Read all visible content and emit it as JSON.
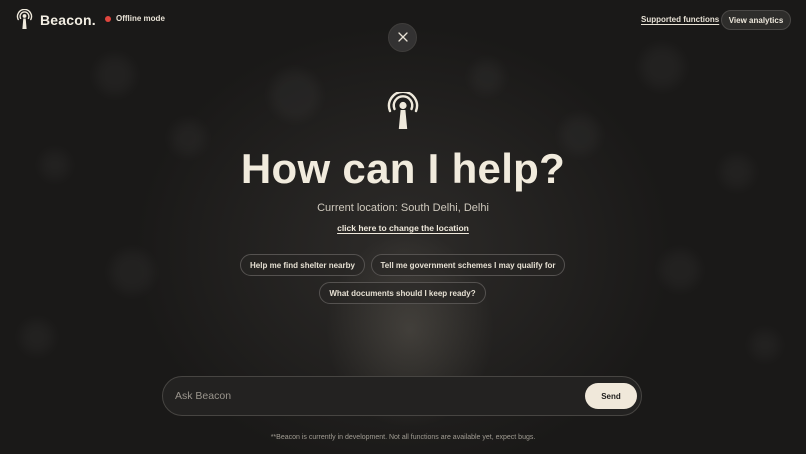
{
  "header": {
    "brand_name": "Beacon.",
    "offline_label": "Offline mode",
    "supported_link": "Supported functions",
    "analytics_button": "View analytics"
  },
  "hero": {
    "title": "How can I help?",
    "location_text": "Current location: South Delhi, Delhi",
    "change_location_link": "click here to change the location"
  },
  "suggestions": [
    "Help me find shelter nearby",
    "Tell me government schemes I may qualify for",
    "What documents should I keep ready?"
  ],
  "ask": {
    "placeholder": "Ask Beacon",
    "value": "",
    "send_label": "Send"
  },
  "footer_note": "**Beacon is currently in development. Not all functions are available yet, expect bugs.",
  "colors": {
    "background": "#1a1918",
    "text": "#f1ebdd",
    "offline_dot": "#e0463e",
    "send_button": "#f0e8da"
  },
  "icons": {
    "brand": "beacon-antenna-icon",
    "close": "close-icon",
    "hero": "beacon-antenna-icon"
  }
}
